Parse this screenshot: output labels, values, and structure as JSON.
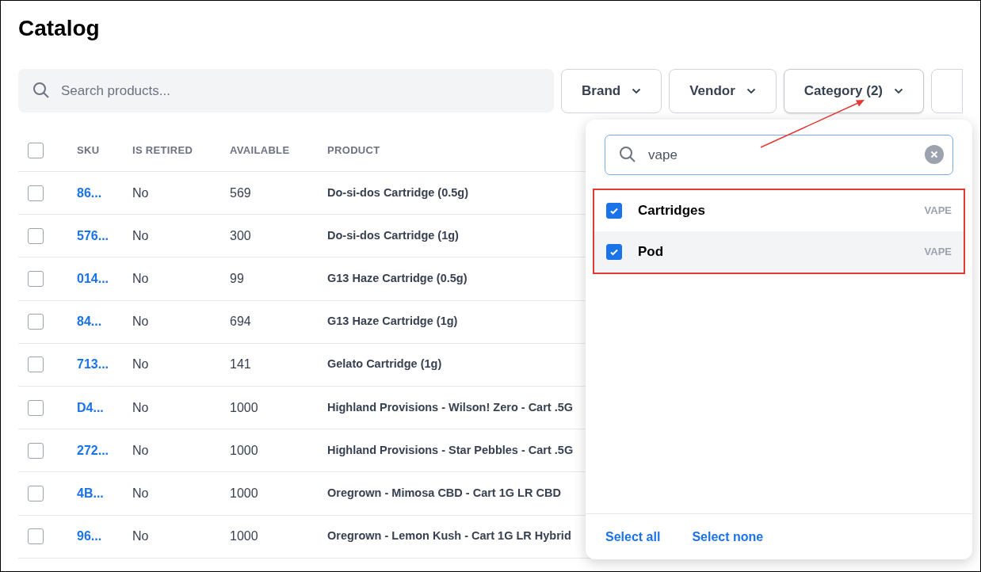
{
  "title": "Catalog",
  "search": {
    "placeholder": "Search products..."
  },
  "filters": [
    {
      "label": "Brand",
      "active": false
    },
    {
      "label": "Vendor",
      "active": false
    },
    {
      "label": "Category (2)",
      "active": true
    }
  ],
  "table": {
    "select_all_checked": false,
    "columns": [
      "SKU",
      "IS RETIRED",
      "AVAILABLE",
      "PRODUCT"
    ],
    "rows": [
      {
        "sku": "86...",
        "retired": "No",
        "available": "569",
        "product": "Do-si-dos Cartridge (0.5g)",
        "checked": false
      },
      {
        "sku": "576...",
        "retired": "No",
        "available": "300",
        "product": "Do-si-dos Cartridge (1g)",
        "checked": false
      },
      {
        "sku": "014...",
        "retired": "No",
        "available": "99",
        "product": "G13 Haze Cartridge (0.5g)",
        "checked": false
      },
      {
        "sku": "84...",
        "retired": "No",
        "available": "694",
        "product": "G13 Haze Cartridge (1g)",
        "checked": false
      },
      {
        "sku": "713...",
        "retired": "No",
        "available": "141",
        "product": "Gelato Cartridge (1g)",
        "checked": false
      },
      {
        "sku": "D4...",
        "retired": "No",
        "available": "1000",
        "product": "Highland Provisions - Wilson! Zero - Cart .5G",
        "checked": false
      },
      {
        "sku": "272...",
        "retired": "No",
        "available": "1000",
        "product": "Highland Provisions - Star Pebbles - Cart .5G",
        "checked": false
      },
      {
        "sku": "4B...",
        "retired": "No",
        "available": "1000",
        "product": "Oregrown - Mimosa CBD - Cart 1G LR CBD",
        "checked": false
      },
      {
        "sku": "96...",
        "retired": "No",
        "available": "1000",
        "product": "Oregrown - Lemon Kush - Cart 1G LR Hybrid",
        "checked": false
      }
    ]
  },
  "popover": {
    "search_value": "vape",
    "options": [
      {
        "label": "Cartridges",
        "tag": "VAPE",
        "checked": true,
        "hovered": false
      },
      {
        "label": "Pod",
        "tag": "VAPE",
        "checked": true,
        "hovered": true
      }
    ],
    "actions": [
      "Select all",
      "Select none"
    ]
  }
}
